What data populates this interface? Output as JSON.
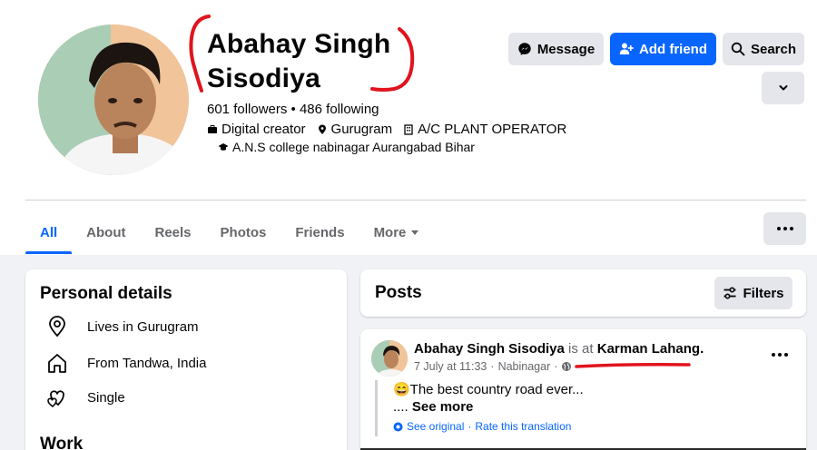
{
  "profile": {
    "name_line1": "Abahay Singh",
    "name_line2": "Sisodiya",
    "follow_stats": "601 followers • 486 following",
    "intro": {
      "category": "Digital creator",
      "location": "Gurugram",
      "job": "A/C PLANT OPERATOR",
      "education": "A.N.S college nabinagar Aurangabad Bihar"
    }
  },
  "actions": {
    "message": "Message",
    "add_friend": "Add friend",
    "search": "Search"
  },
  "tabs": [
    {
      "label": "All"
    },
    {
      "label": "About"
    },
    {
      "label": "Reels"
    },
    {
      "label": "Photos"
    },
    {
      "label": "Friends"
    },
    {
      "label": "More"
    }
  ],
  "details": {
    "title": "Personal details",
    "lives_in": "Lives in Gurugram",
    "from": "From Tandwa, India",
    "relationship": "Single",
    "work_title": "Work"
  },
  "posts": {
    "title": "Posts",
    "filters": "Filters",
    "post": {
      "author": "Abahay Singh Sisodiya",
      "connector": "is at",
      "place": "Karman Lahang",
      "period": ".",
      "date": "7 July at 11:33",
      "location": "Nabinagar",
      "separator": "·",
      "text": "😄The best country road ever...",
      "see_more_prefix": "....",
      "see_more": "See more",
      "see_original": "See original",
      "rate_translation": "Rate this translation"
    }
  },
  "colors": {
    "accent": "#0866ff",
    "button_grey": "#e4e6eb",
    "feed_bg": "#f0f2f5",
    "annotation_red": "#e0141e"
  }
}
